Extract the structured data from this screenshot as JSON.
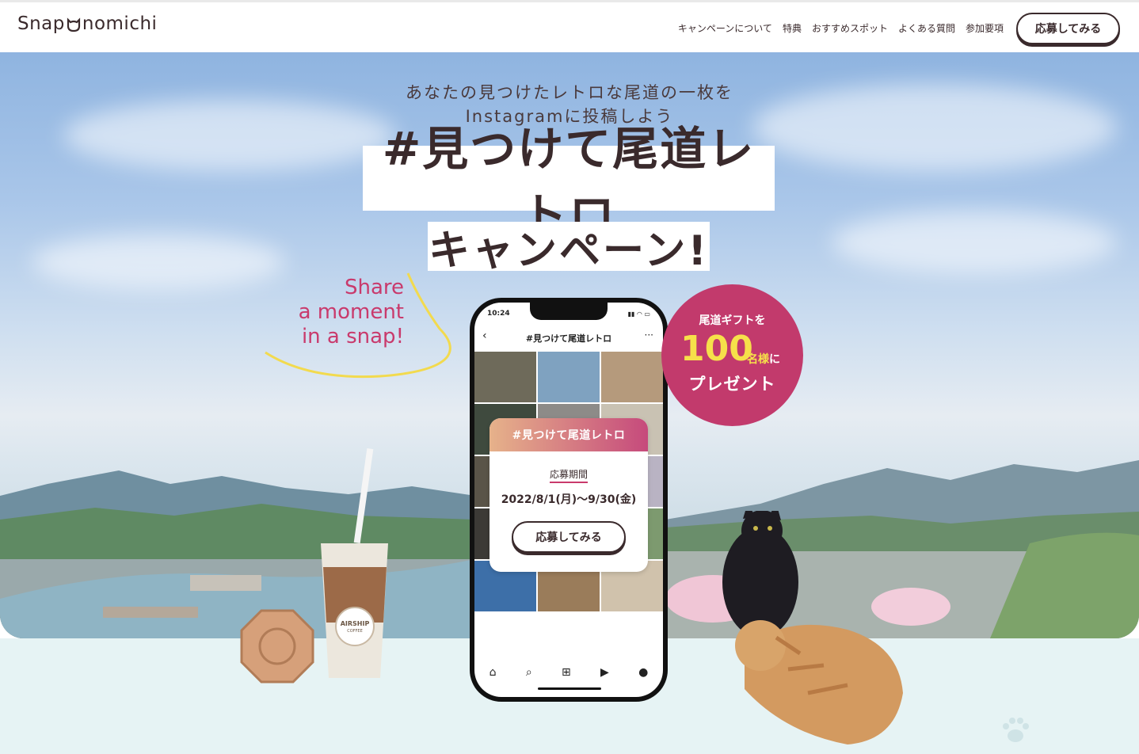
{
  "header": {
    "logo_text_a": "Snap",
    "logo_text_b": "nomichi",
    "nav": [
      "キャンペーンについて",
      "特典",
      "おすすめスポット",
      "よくある質問",
      "参加要項"
    ],
    "cta_label": "応募してみる"
  },
  "hero": {
    "tagline_line1": "あなたの見つけたレトロな尾道の一枚を",
    "tagline_line2": "Instagramに投稿しよう",
    "title_line1": "#見つけて尾道レトロ",
    "title_line2": "キャンペーン!",
    "share_line1": "Share",
    "share_line2": "a moment",
    "share_line3": "in a snap!"
  },
  "phone": {
    "time": "10:24",
    "hashtag": "#見つけて尾道レトロ",
    "card": {
      "title": "#見つけて尾道レトロ",
      "period_label": "応募期間",
      "period": "2022/8/1(月)〜9/30(金)",
      "button": "応募してみる"
    }
  },
  "gift": {
    "line1": "尾道ギフトを",
    "number": "100",
    "suffix_a": "名様",
    "suffix_b": "に",
    "line3": "プレゼント"
  },
  "props": {
    "cup_brand": "AIRSHIP",
    "cup_sub": "COFFEE"
  },
  "colors": {
    "accent": "#c23a6c",
    "text": "#3a2a2c",
    "highlight": "#f6e04a"
  }
}
